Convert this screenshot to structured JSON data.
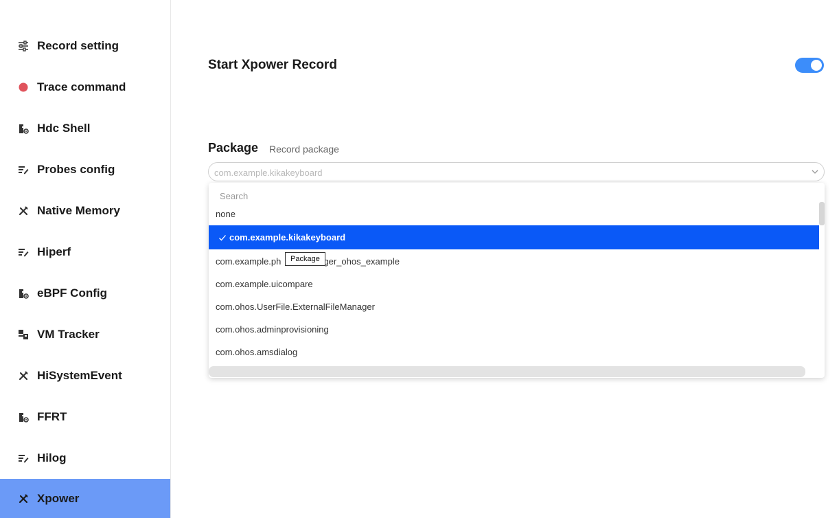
{
  "sidebar": {
    "items": [
      {
        "label": "Record setting",
        "icon": "sliders-icon"
      },
      {
        "label": "Trace command",
        "icon": "red-dot-icon"
      },
      {
        "label": "Hdc Shell",
        "icon": "puzzle-gear-icon"
      },
      {
        "label": "Probes config",
        "icon": "edit-list-icon"
      },
      {
        "label": "Native Memory",
        "icon": "tools-icon"
      },
      {
        "label": "Hiperf",
        "icon": "edit-list-icon"
      },
      {
        "label": "eBPF Config",
        "icon": "puzzle-gear-icon"
      },
      {
        "label": "VM Tracker",
        "icon": "vm-icon"
      },
      {
        "label": "HiSystemEvent",
        "icon": "tools-icon"
      },
      {
        "label": "FFRT",
        "icon": "puzzle-gear-icon"
      },
      {
        "label": "Hilog",
        "icon": "edit-list-icon"
      },
      {
        "label": "Xpower",
        "icon": "tools-icon"
      }
    ],
    "active_index": 11
  },
  "main": {
    "title": "Start Xpower Record",
    "toggle_on": true,
    "package_label": "Package",
    "package_sub": "Record package",
    "select_value": "com.example.kikakeyboard"
  },
  "dropdown": {
    "search_placeholder": "Search",
    "options": [
      "none",
      "com.example.kikakeyboard",
      "com.example.ph",
      "com.example.uicompare",
      "com.ohos.UserFile.ExternalFileManager",
      "com.ohos.adminprovisioning",
      "com.ohos.amsdialog"
    ],
    "option2_suffix": "ger_ohos_example",
    "selected_index": 1,
    "tooltip": "Package"
  },
  "colors": {
    "accent": "#0a59f7",
    "active_nav": "#6b9af7",
    "toggle": "#3c8dfa",
    "trace_dot": "#e0535c"
  }
}
